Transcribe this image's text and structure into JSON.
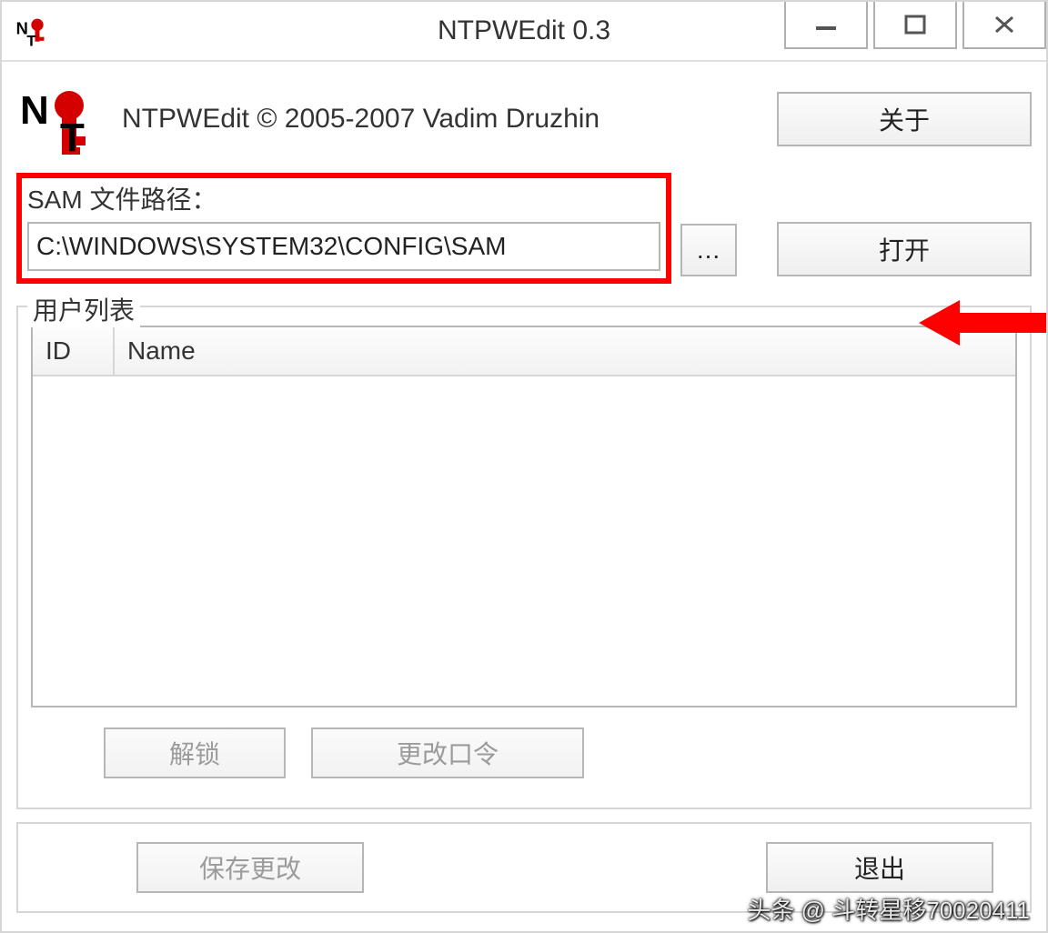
{
  "window": {
    "title": "NTPWEdit 0.3"
  },
  "header": {
    "copyright": "NTPWEdit © 2005-2007 Vadim Druzhin",
    "about_button": "关于"
  },
  "sam": {
    "label": "SAM 文件路径：",
    "path": "C:\\WINDOWS\\SYSTEM32\\CONFIG\\SAM",
    "browse_button": "...",
    "open_button": "打开"
  },
  "userlist": {
    "legend": "用户列表",
    "columns": {
      "id": "ID",
      "name": "Name"
    },
    "rows": []
  },
  "actions": {
    "unlock": "解锁",
    "change_password": "更改口令",
    "save_changes": "保存更改",
    "exit": "退出"
  },
  "watermark": "头条 @ 斗转星移70020411"
}
